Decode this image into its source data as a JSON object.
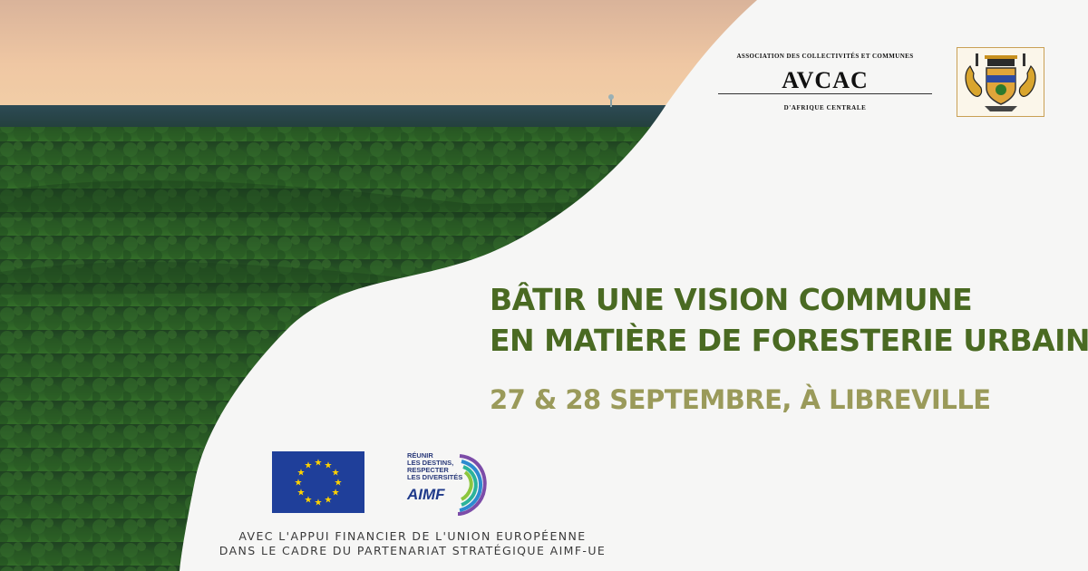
{
  "association": {
    "top_text": "ASSOCIATION DES COLLECTIVITÉS ET COMMUNES",
    "name": "AVCAC",
    "bottom_text": "D'AFRIQUE CENTRALE"
  },
  "headline": {
    "line1": "BÂTIR UNE VISION COMMUNE",
    "line2": "EN MATIÈRE DE FORESTERIE URBAINE"
  },
  "date_location": "27 & 28 SEPTEMBRE, À LIBREVILLE",
  "aimf": {
    "tagline_1": "RÉUNIR",
    "tagline_2": "LES DESTINS,",
    "tagline_3": "RESPECTER",
    "tagline_4": "LES DIVERSITÉS",
    "name": "AIMF"
  },
  "footer": {
    "line1": "AVEC L'APPUI FINANCIER DE L'UNION EUROPÉENNE",
    "line2": "DANS LE CADRE DU PARTENARIAT STRATÉGIQUE AIMF-UE"
  },
  "colors": {
    "headline": "#4a6a22",
    "date": "#9a9a5a",
    "eu_blue": "#1f3f9a",
    "eu_star": "#ffd200",
    "background": "#f6f6f5"
  },
  "icons": [
    "forest-photo",
    "eu-flag-icon",
    "aimf-logo-icon",
    "coat-of-arms-icon"
  ]
}
